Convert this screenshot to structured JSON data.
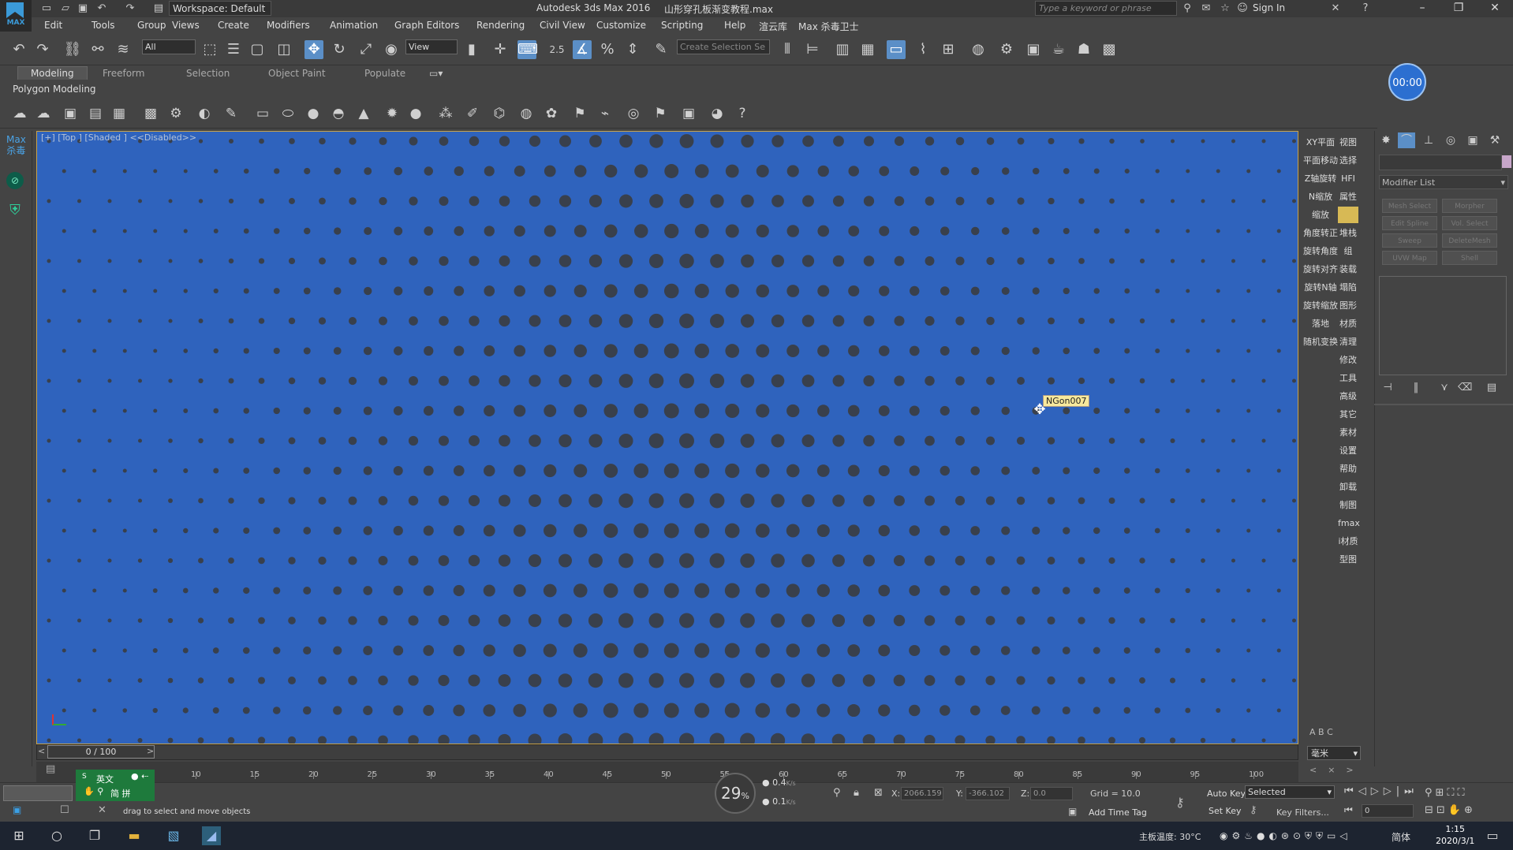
{
  "window": {
    "app_title": "Autodesk 3ds Max 2016",
    "file_title": "山形穿孔板渐变教程.max",
    "workspace_label": "Workspace: Default",
    "search_placeholder": "Type a keyword or phrase",
    "sign_in": "Sign In",
    "logo_text": "MAX"
  },
  "menu": [
    "Edit",
    "Tools",
    "Group",
    "Views",
    "Create",
    "Modifiers",
    "Animation",
    "Graph Editors",
    "Rendering",
    "Civil View",
    "Customize",
    "Scripting",
    "Help",
    "渲云库",
    "Max 杀毒卫士"
  ],
  "main_toolbar": {
    "filter_select": "All",
    "refcoord_select": "View",
    "snap_label": "2.5",
    "selection_set_placeholder": "Create Selection Se"
  },
  "ribbon": {
    "tabs": [
      "Modeling",
      "Freeform",
      "Selection",
      "Object Paint",
      "Populate"
    ],
    "active_tab": "Modeling",
    "panel_label": "Polygon Modeling"
  },
  "timer": "00:00",
  "left_strip": {
    "label_line1": "Max",
    "label_line2": "杀毒"
  },
  "viewport": {
    "label_bracket": "[+] [Top ] [Shaded ]",
    "label_disabled": "<<Disabled>>",
    "tooltip": "NGon007",
    "background_color": "#2f63bd",
    "dot_color": "#3b3d42"
  },
  "right_column": {
    "left_buttons": [
      "XY平面",
      "平面移动",
      "Z轴旋转",
      "N缩放",
      "缩放",
      "角度转正",
      "旋转角度",
      "旋转对齐",
      "旋转N轴",
      "旋转缩放",
      "落地",
      "随机变换"
    ],
    "right_buttons": [
      "视图",
      "选择",
      "HFI",
      "属性",
      "",
      "堆栈",
      "组",
      "装载",
      "塌陷",
      "图形",
      "材质",
      "清理",
      "修改",
      "工具",
      "高级",
      "其它",
      "素材",
      "设置",
      "帮助",
      "卸载",
      "制图",
      "fmax",
      "i材质",
      "型图"
    ]
  },
  "command_panel": {
    "modifier_list": "Modifier List",
    "modifier_buttons": [
      "Mesh Select",
      "Morpher",
      "Edit Spline",
      "Vol. Select",
      "Sweep",
      "DeleteMesh",
      "UVW Map",
      "Shell"
    ]
  },
  "time_slider": {
    "label": "0 / 100"
  },
  "track_ticks": [
    "10",
    "15",
    "20",
    "25",
    "30",
    "35",
    "40",
    "45",
    "50",
    "55",
    "60",
    "65",
    "70",
    "75",
    "80",
    "85",
    "90",
    "95",
    "100"
  ],
  "lower_right": {
    "abc": "A  B  C",
    "units": "毫米"
  },
  "status": {
    "message": "drag to select and move objects",
    "ime_line1": "英文",
    "ime_line2": "简 拼",
    "speed_value": "29",
    "speed_unit": "%",
    "net_up": "0.4",
    "net_up_unit": "K/s",
    "net_down": "0.1",
    "net_down_unit": "K/s",
    "x_label": "X:",
    "x_value": "2066.159",
    "y_label": "Y:",
    "y_value": "-366.102",
    "z_label": "Z:",
    "z_value": "0.0",
    "grid": "Grid = 10.0",
    "add_time_tag": "Add Time Tag",
    "auto_key": "Auto Key",
    "set_key": "Set Key",
    "key_mode": "Selected",
    "key_filters": "Key Filters...",
    "frame_field": "0"
  },
  "taskbar": {
    "temperature": "主板温度: 30°C",
    "ime": "简体",
    "time": "1:15",
    "date": "2020/3/1"
  }
}
